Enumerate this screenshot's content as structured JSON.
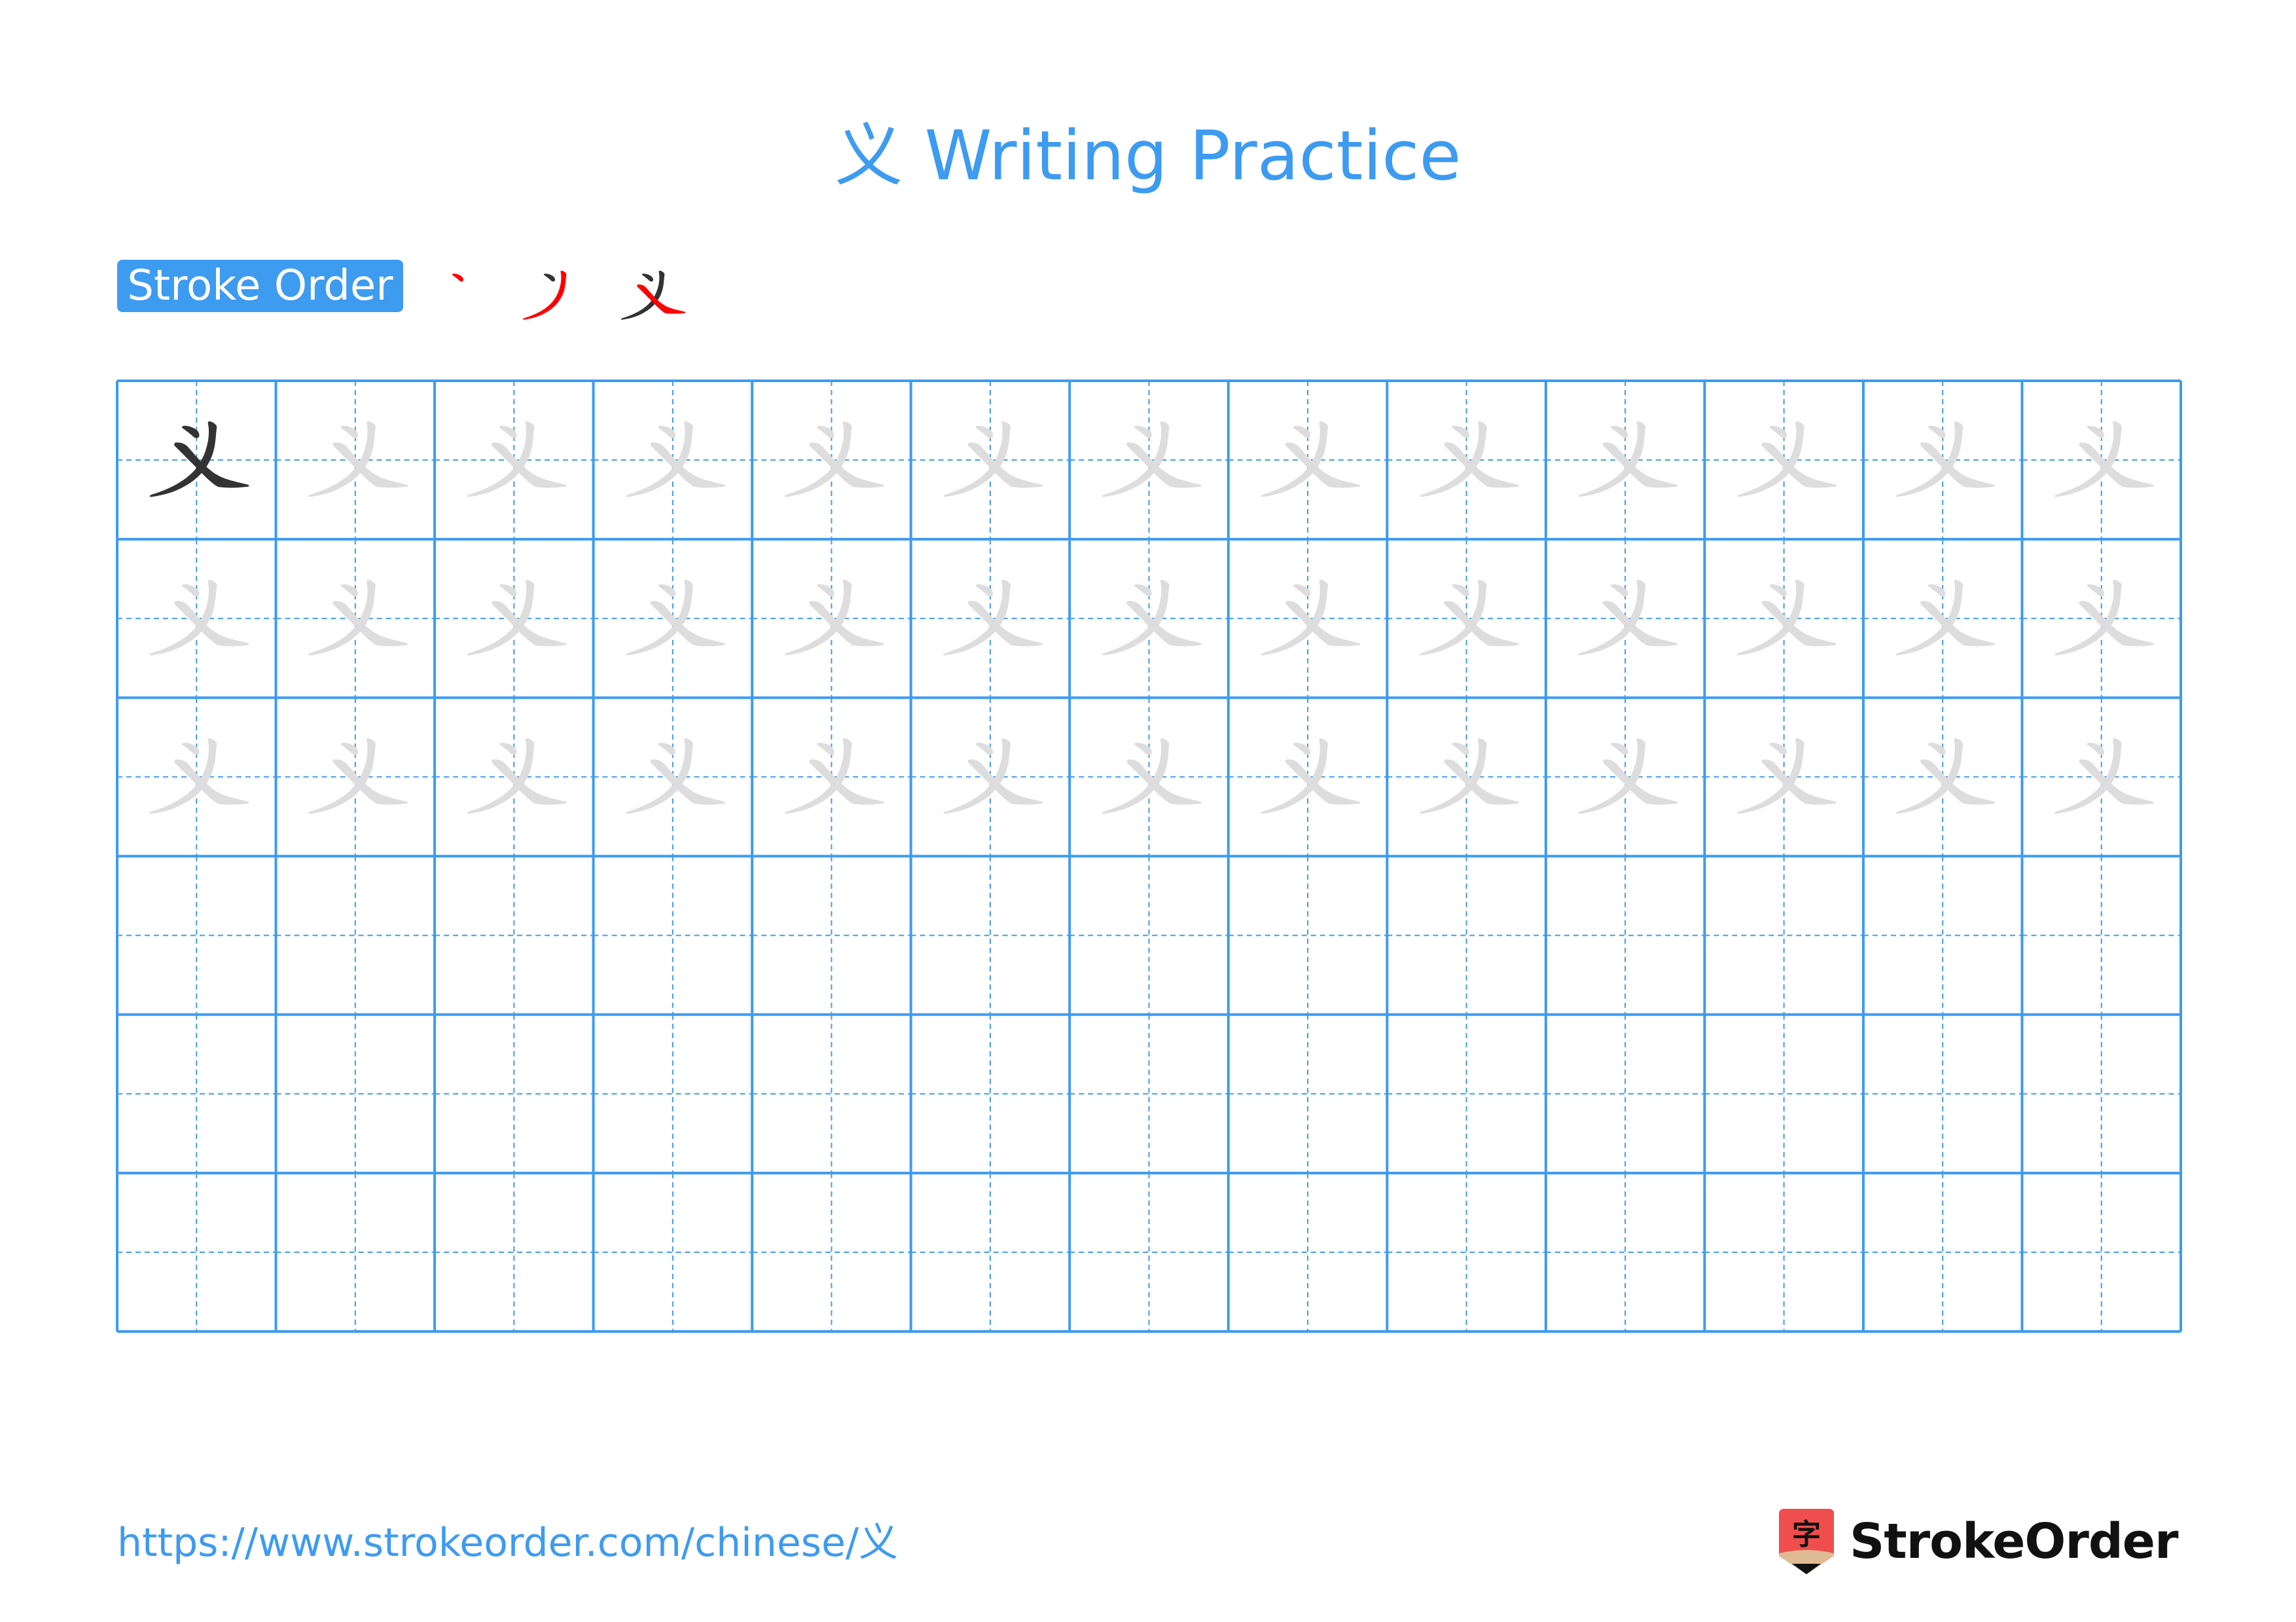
{
  "title": "义 Writing Practice",
  "character": "义",
  "stroke_order": {
    "label": "Stroke Order",
    "step_count": 3
  },
  "grid": {
    "columns": 13,
    "rows": 6,
    "trace_rows": 3,
    "model_cells": 1
  },
  "colors": {
    "accent": "#3d9bf0",
    "model_stroke": "#333333",
    "trace_stroke": "#dddddd",
    "highlight_stroke": "#ff0000",
    "logo_red": "#f04e4e",
    "logo_tan": "#dfbb94"
  },
  "footer": {
    "url": "https://www.strokeorder.com/chinese/义",
    "brand": "StrokeOrder",
    "brand_icon_char": "字"
  }
}
